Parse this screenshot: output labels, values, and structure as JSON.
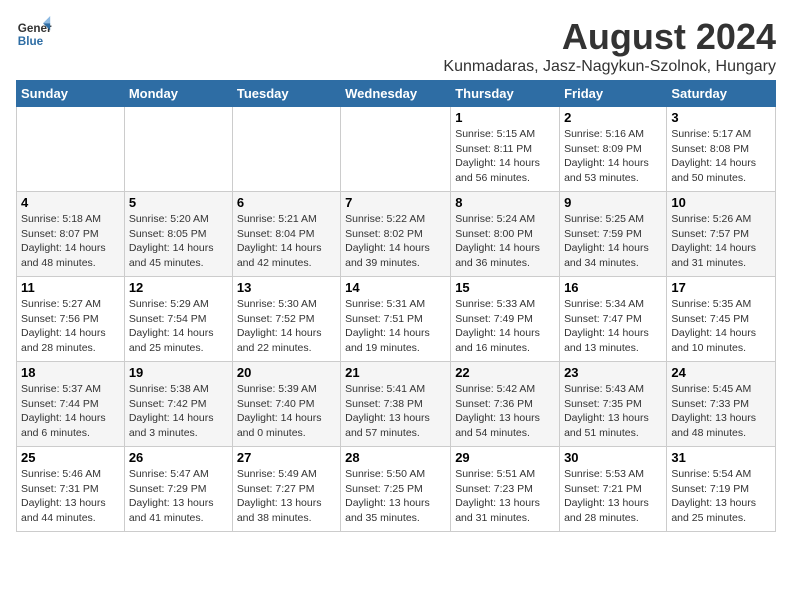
{
  "logo": {
    "general": "General",
    "blue": "Blue"
  },
  "title": "August 2024",
  "subtitle": "Kunmadaras, Jasz-Nagykun-Szolnok, Hungary",
  "days_of_week": [
    "Sunday",
    "Monday",
    "Tuesday",
    "Wednesday",
    "Thursday",
    "Friday",
    "Saturday"
  ],
  "weeks": [
    [
      {
        "day": "",
        "info": ""
      },
      {
        "day": "",
        "info": ""
      },
      {
        "day": "",
        "info": ""
      },
      {
        "day": "",
        "info": ""
      },
      {
        "day": "1",
        "info": "Sunrise: 5:15 AM\nSunset: 8:11 PM\nDaylight: 14 hours\nand 56 minutes."
      },
      {
        "day": "2",
        "info": "Sunrise: 5:16 AM\nSunset: 8:09 PM\nDaylight: 14 hours\nand 53 minutes."
      },
      {
        "day": "3",
        "info": "Sunrise: 5:17 AM\nSunset: 8:08 PM\nDaylight: 14 hours\nand 50 minutes."
      }
    ],
    [
      {
        "day": "4",
        "info": "Sunrise: 5:18 AM\nSunset: 8:07 PM\nDaylight: 14 hours\nand 48 minutes."
      },
      {
        "day": "5",
        "info": "Sunrise: 5:20 AM\nSunset: 8:05 PM\nDaylight: 14 hours\nand 45 minutes."
      },
      {
        "day": "6",
        "info": "Sunrise: 5:21 AM\nSunset: 8:04 PM\nDaylight: 14 hours\nand 42 minutes."
      },
      {
        "day": "7",
        "info": "Sunrise: 5:22 AM\nSunset: 8:02 PM\nDaylight: 14 hours\nand 39 minutes."
      },
      {
        "day": "8",
        "info": "Sunrise: 5:24 AM\nSunset: 8:00 PM\nDaylight: 14 hours\nand 36 minutes."
      },
      {
        "day": "9",
        "info": "Sunrise: 5:25 AM\nSunset: 7:59 PM\nDaylight: 14 hours\nand 34 minutes."
      },
      {
        "day": "10",
        "info": "Sunrise: 5:26 AM\nSunset: 7:57 PM\nDaylight: 14 hours\nand 31 minutes."
      }
    ],
    [
      {
        "day": "11",
        "info": "Sunrise: 5:27 AM\nSunset: 7:56 PM\nDaylight: 14 hours\nand 28 minutes."
      },
      {
        "day": "12",
        "info": "Sunrise: 5:29 AM\nSunset: 7:54 PM\nDaylight: 14 hours\nand 25 minutes."
      },
      {
        "day": "13",
        "info": "Sunrise: 5:30 AM\nSunset: 7:52 PM\nDaylight: 14 hours\nand 22 minutes."
      },
      {
        "day": "14",
        "info": "Sunrise: 5:31 AM\nSunset: 7:51 PM\nDaylight: 14 hours\nand 19 minutes."
      },
      {
        "day": "15",
        "info": "Sunrise: 5:33 AM\nSunset: 7:49 PM\nDaylight: 14 hours\nand 16 minutes."
      },
      {
        "day": "16",
        "info": "Sunrise: 5:34 AM\nSunset: 7:47 PM\nDaylight: 14 hours\nand 13 minutes."
      },
      {
        "day": "17",
        "info": "Sunrise: 5:35 AM\nSunset: 7:45 PM\nDaylight: 14 hours\nand 10 minutes."
      }
    ],
    [
      {
        "day": "18",
        "info": "Sunrise: 5:37 AM\nSunset: 7:44 PM\nDaylight: 14 hours\nand 6 minutes."
      },
      {
        "day": "19",
        "info": "Sunrise: 5:38 AM\nSunset: 7:42 PM\nDaylight: 14 hours\nand 3 minutes."
      },
      {
        "day": "20",
        "info": "Sunrise: 5:39 AM\nSunset: 7:40 PM\nDaylight: 14 hours\nand 0 minutes."
      },
      {
        "day": "21",
        "info": "Sunrise: 5:41 AM\nSunset: 7:38 PM\nDaylight: 13 hours\nand 57 minutes."
      },
      {
        "day": "22",
        "info": "Sunrise: 5:42 AM\nSunset: 7:36 PM\nDaylight: 13 hours\nand 54 minutes."
      },
      {
        "day": "23",
        "info": "Sunrise: 5:43 AM\nSunset: 7:35 PM\nDaylight: 13 hours\nand 51 minutes."
      },
      {
        "day": "24",
        "info": "Sunrise: 5:45 AM\nSunset: 7:33 PM\nDaylight: 13 hours\nand 48 minutes."
      }
    ],
    [
      {
        "day": "25",
        "info": "Sunrise: 5:46 AM\nSunset: 7:31 PM\nDaylight: 13 hours\nand 44 minutes."
      },
      {
        "day": "26",
        "info": "Sunrise: 5:47 AM\nSunset: 7:29 PM\nDaylight: 13 hours\nand 41 minutes."
      },
      {
        "day": "27",
        "info": "Sunrise: 5:49 AM\nSunset: 7:27 PM\nDaylight: 13 hours\nand 38 minutes."
      },
      {
        "day": "28",
        "info": "Sunrise: 5:50 AM\nSunset: 7:25 PM\nDaylight: 13 hours\nand 35 minutes."
      },
      {
        "day": "29",
        "info": "Sunrise: 5:51 AM\nSunset: 7:23 PM\nDaylight: 13 hours\nand 31 minutes."
      },
      {
        "day": "30",
        "info": "Sunrise: 5:53 AM\nSunset: 7:21 PM\nDaylight: 13 hours\nand 28 minutes."
      },
      {
        "day": "31",
        "info": "Sunrise: 5:54 AM\nSunset: 7:19 PM\nDaylight: 13 hours\nand 25 minutes."
      }
    ]
  ]
}
